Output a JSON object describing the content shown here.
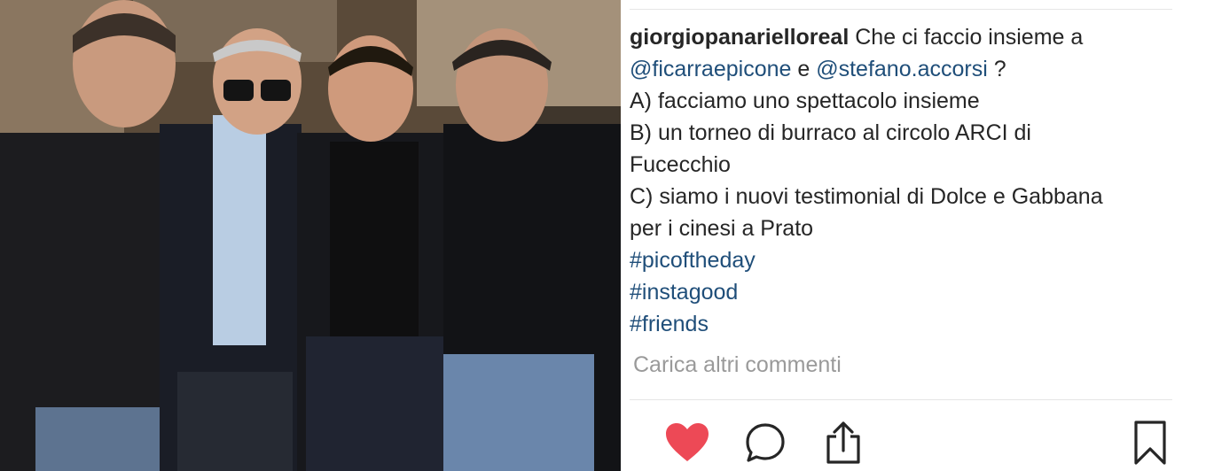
{
  "post": {
    "username": "giorgiopanarielloreal",
    "caption_intro": "Che ci faccio insieme a",
    "mention_1": "@ficarraepicone",
    "conjunction": "e",
    "mention_2": "@stefano.accorsi",
    "question_mark": "?",
    "option_a": "A) facciamo uno spettacolo insieme",
    "option_b_line1": "B) un torneo di burraco al circolo ARCI di",
    "option_b_line2": "Fucecchio",
    "option_c_line1": "C) siamo i nuovi testimonial di Dolce e Gabbana",
    "option_c_line2": "per i cinesi a Prato",
    "hashtags": [
      "#picoftheday",
      "#instagood",
      "#friends"
    ]
  },
  "comments": {
    "load_more_label": "Carica altri commenti"
  },
  "actions": {
    "like_icon": "heart-filled-icon",
    "comment_icon": "comment-bubble-icon",
    "share_icon": "share-upload-icon",
    "save_icon": "bookmark-icon",
    "liked_color": "#ed4956"
  },
  "colors": {
    "text": "#262626",
    "link": "#1f4e79",
    "muted": "#9a9a9a"
  }
}
